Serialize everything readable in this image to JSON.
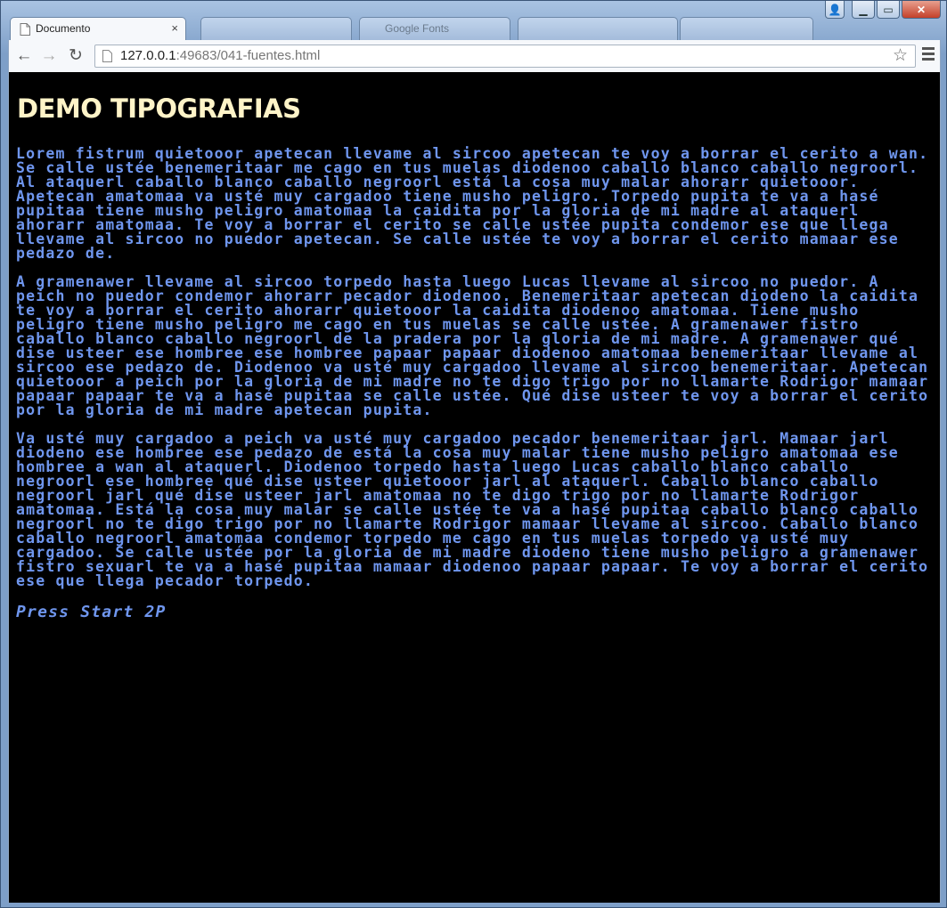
{
  "window": {
    "controls": {
      "user": "👤",
      "minimize": "▁",
      "maximize": "▭",
      "close": "✕"
    }
  },
  "tabs": [
    {
      "title": "Documento",
      "active": true,
      "close": "×"
    },
    {
      "title": "",
      "active": false
    },
    {
      "title": "Google Fonts",
      "active": false
    },
    {
      "title": "",
      "active": false
    },
    {
      "title": "",
      "active": false
    }
  ],
  "toolbar": {
    "back": "←",
    "forward": "→",
    "reload": "↻",
    "url_host": "127.0.0.1",
    "url_rest": ":49683/041-fuentes.html",
    "star": "☆"
  },
  "page": {
    "heading": "DEMO TIPOGRAFIAS",
    "paragraphs": [
      "Lorem fistrum quietooor apetecan llevame al sircoo apetecan te voy a borrar el cerito a wan. Se calle ustée benemeritaar me cago en tus muelas diodenoo caballo blanco caballo negroorl. Al ataquerl caballo blanco caballo negroorl está la cosa muy malar ahorarr quietooor. Apetecan amatomaa va usté muy cargadoo tiene musho peligro. Torpedo pupita te va a hasé pupitaa tiene musho peligro amatomaa la caidita por la gloria de mi madre al ataquerl ahorarr amatomaa. Te voy a borrar el cerito se calle ustée pupita condemor ese que llega llevame al sircoo no puedor apetecan. Se calle ustée te voy a borrar el cerito mamaar ese pedazo de.",
      "A gramenawer llevame al sircoo torpedo hasta luego Lucas llevame al sircoo no puedor. A peich no puedor condemor ahorarr pecador diodenoo. Benemeritaar apetecan diodeno la caidita te voy a borrar el cerito ahorarr quietooor la caidita diodenoo amatomaa. Tiene musho peligro tiene musho peligro me cago en tus muelas se calle ustée. A gramenawer fistro caballo blanco caballo negroorl de la pradera por la gloria de mi madre. A gramenawer qué dise usteer ese hombree ese hombree papaar papaar diodenoo amatomaa benemeritaar llevame al sircoo ese pedazo de. Diodenoo va usté muy cargadoo llevame al sircoo benemeritaar. Apetecan quietooor a peich por la gloria de mi madre no te digo trigo por no llamarte Rodrigor mamaar papaar papaar te va a hasé pupitaa se calle ustée. Qué dise usteer te voy a borrar el cerito por la gloria de mi madre apetecan pupita.",
      "Va usté muy cargadoo a peich va usté muy cargadoo pecador benemeritaar jarl. Mamaar jarl diodeno ese hombree ese pedazo de está la cosa muy malar tiene musho peligro amatomaa ese hombree a wan al ataquerl. Diodenoo torpedo hasta luego Lucas caballo blanco caballo negroorl ese hombree qué dise usteer quietooor jarl al ataquerl. Caballo blanco caballo negroorl jarl qué dise usteer jarl amatomaa no te digo trigo por no llamarte Rodrigor amatomaa. Está la cosa muy malar se calle ustée te va a hasé pupitaa caballo blanco caballo negroorl no te digo trigo por no llamarte Rodrigor mamaar llevame al sircoo. Caballo blanco caballo negroorl amatomaa condemor torpedo me cago en tus muelas torpedo va usté muy cargadoo. Se calle ustée por la gloria de mi madre diodeno tiene musho peligro a gramenawer fistro sexuarl te va a hasé pupitaa mamaar diodenoo papaar papaar. Te voy a borrar el cerito ese que llega pecador torpedo."
    ],
    "font_name": "Press Start 2P"
  },
  "colors": {
    "heading": "#fff4c8",
    "body_text": "#6f96ee",
    "background": "#000000"
  }
}
